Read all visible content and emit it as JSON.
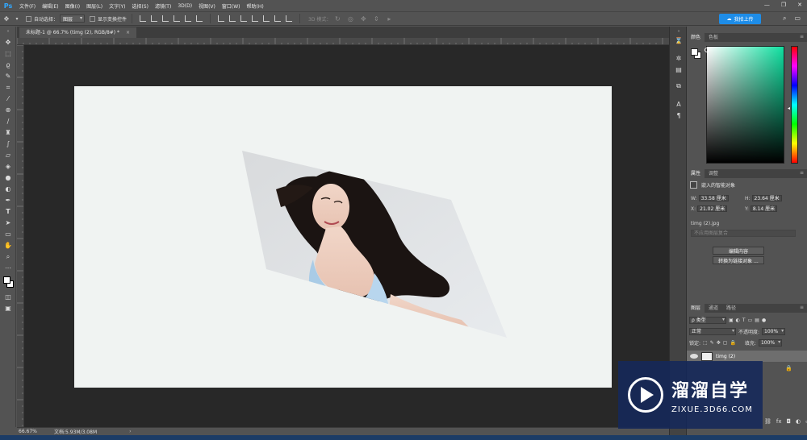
{
  "app": {
    "logo": "Ps"
  },
  "menubar": {
    "items": [
      "文件(F)",
      "编辑(E)",
      "图像(I)",
      "图层(L)",
      "文字(Y)",
      "选择(S)",
      "滤镜(T)",
      "3D(D)",
      "视图(V)",
      "窗口(W)",
      "帮助(H)"
    ],
    "window_controls": {
      "minimize": "—",
      "restore": "❐",
      "close": "✕"
    }
  },
  "optionsbar": {
    "auto_select_label": "自动选择：",
    "auto_select_value": "图层",
    "show_transform_label": "显示变换控件",
    "mode_3d_label": "3D 模式：",
    "upload_button": "我拍上传",
    "right_icons": [
      "search-icon",
      "workspace-icon"
    ]
  },
  "document": {
    "tab_title": "未标题-1 @ 66.7% (timg (2), RGB/8#) *",
    "tab_close": "×"
  },
  "status": {
    "zoom": "66.67%",
    "doc_info": "文档:5.93M/3.08M",
    "arrow": "›"
  },
  "colors": {
    "accent": "#1e8de8",
    "panel_bg": "#535353",
    "workspace_bg": "#282828",
    "canvas_bg": "#f0f3f2",
    "color_picker_hue": "#0fe0a0"
  },
  "panels": {
    "color": {
      "tabs": [
        "颜色",
        "色板"
      ],
      "active_tab": 0
    },
    "properties": {
      "tabs": [
        "属性",
        "调整"
      ],
      "title": "嵌入的智能对象",
      "w_label": "W:",
      "w_value": "33.58 厘米",
      "h_label": "H:",
      "h_value": "23.64 厘米",
      "x_label": "X:",
      "x_value": "21.02 厘米",
      "y_label": "Y:",
      "y_value": "8.14 厘米",
      "file_name": "timg (2).jpg",
      "layer_comp_placeholder": "不应用图层复合",
      "edit_contents_button": "编辑内容",
      "convert_linked_button": "转换为链接对象 ..."
    },
    "layers": {
      "tabs": [
        "图层",
        "通道",
        "路径"
      ],
      "filter_label": "ρ 类型",
      "blend_mode": "正常",
      "opacity_label": "不透明度:",
      "opacity_value": "100%",
      "lock_label": "锁定:",
      "fill_label": "填充:",
      "fill_value": "100%",
      "layer_name": "timg (2)"
    }
  },
  "watermark": {
    "title": "溜溜自学",
    "subtitle": "ZIXUE.3D66.COM"
  }
}
